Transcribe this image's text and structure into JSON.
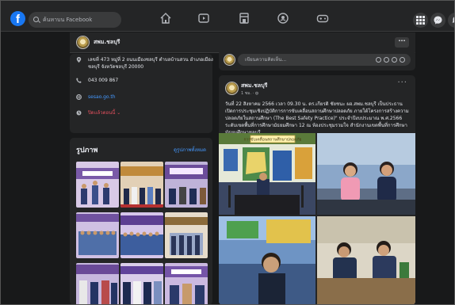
{
  "nav": {
    "logo": "f",
    "search_placeholder": "ค้นหาบน Facebook",
    "icons": [
      "home-icon",
      "video-icon",
      "marketplace-icon",
      "groups-icon",
      "gaming-icon"
    ],
    "right_icons": [
      "apps-grid-icon",
      "messenger-icon",
      "notifications-icon"
    ]
  },
  "page": {
    "name": "สพม.ชลบุรี",
    "more_label": "···"
  },
  "about": {
    "address_line1": "เลขที่ 473 หมู่ที่ 2 ถนนเมืองชลบุรี ตำบลบ้านสวน อำเภอเมือง",
    "address_line2": "ชลบุรี จังหวัดชลบุรี 20000",
    "phone": "043 009 867",
    "website": "sesao.go.th",
    "status": "ปิดแล้วตอนนี้",
    "status_chevron": "⌄"
  },
  "photos": {
    "title": "รูปภาพ",
    "see_all": "ดูรูปภาพทั้งหมด"
  },
  "composer": {
    "placeholder": "เขียนความคิดเห็น..."
  },
  "post": {
    "author": "สพม.ชลบุรี",
    "time": "1 ชม. · ◍",
    "more": "···",
    "text": "วันที่ 22 สิงหาคม 2566 เวลา 09.30 น. ดร.เกียรติ ชัยชนะ ผอ.สพม.ชลบุรี เป็นประธานเปิดการประชุมเชิงปฏิบัติการการขับเคลื่อนสถานศึกษาปลอดภัย ภายใต้โครงการสร้างความปลอดภัยในสถานศึกษา (The Best Safety Practice)\" ประจำปีงบประมาณ พ.ศ.2566 ระดับเขตพื้นที่การศึกษามัธยมศึกษา 12 ณ ห้องประชุมรวมใจ สำนักงานเขตพื้นที่การศึกษามัธยมศึกษาชลบุรี",
    "slide_title": "การขับเคลื่อนสถานศึกษาปลอดภัย"
  },
  "colors": {
    "background": "#18191a",
    "surface": "#242526",
    "accent": "#1877f2",
    "link": "#4599ff"
  }
}
